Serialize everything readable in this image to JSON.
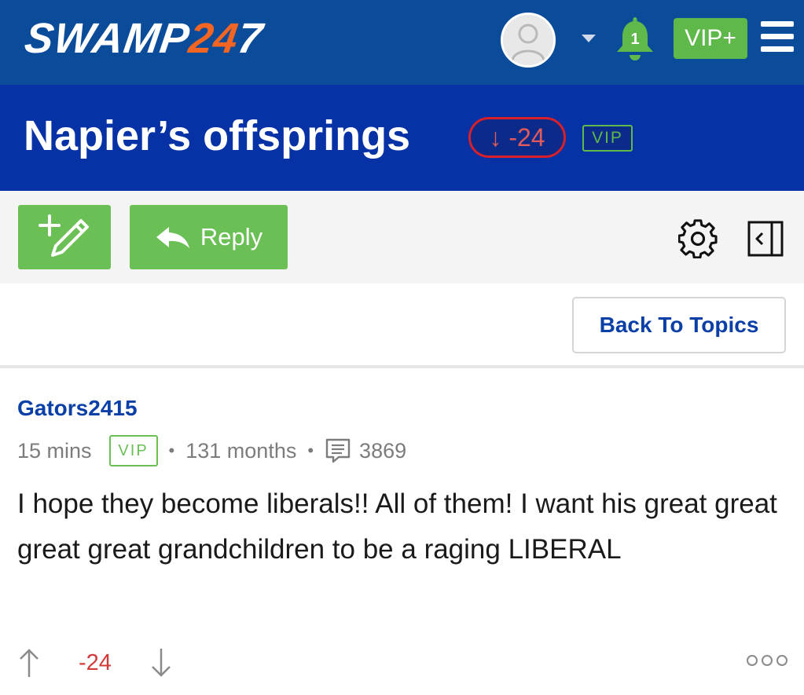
{
  "header": {
    "logo": {
      "part1": "SWAMP",
      "part2": "24",
      "part3": "7"
    },
    "notification_count": "1",
    "vip_label": "VIP+",
    "brand_blue": "#0a4c9a",
    "accent_orange": "#f26522",
    "accent_green": "#5fb84a"
  },
  "thread": {
    "title": "Napier’s offsprings",
    "score": "↓ -24",
    "vip_badge": "VIP",
    "band_color": "#0632a6"
  },
  "toolbar": {
    "new_post_icon": "pencil-plus-icon",
    "reply_label": "Reply",
    "settings_icon": "gear-icon",
    "collapse_icon": "collapse-panel-icon"
  },
  "nav": {
    "back_label": "Back To Topics"
  },
  "post": {
    "username": "Gators2415",
    "time": "15 mins",
    "vip_badge": "VIP",
    "tenure": "131 months",
    "post_count": "3869",
    "body": "I hope they become liberals!! All of them! I want his great great great great grandchildren to be a raging LIBERAL",
    "vote_count": "-24",
    "vote_color": "#d33b3b",
    "more_icon": "more-options-icon"
  }
}
